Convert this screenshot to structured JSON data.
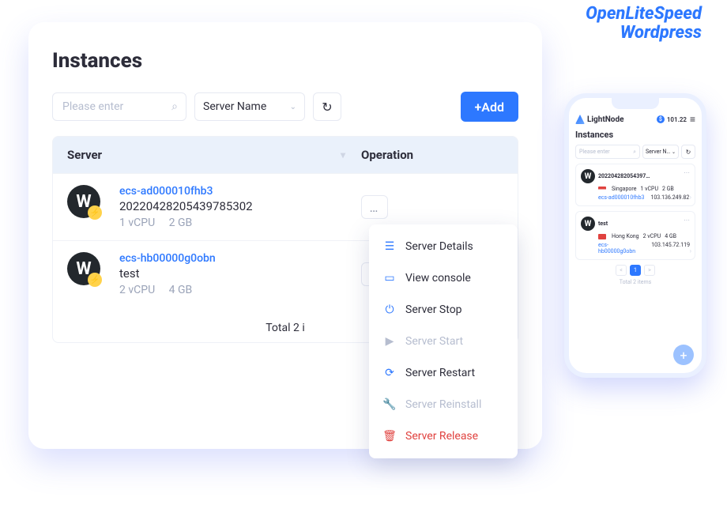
{
  "watermark": {
    "line1": "OpenLiteSpeed",
    "line2": "Wordpress"
  },
  "page": {
    "title": "Instances"
  },
  "toolbar": {
    "search_placeholder": "Please enter",
    "select_label": "Server Name",
    "add_label": "+Add"
  },
  "table": {
    "col_server": "Server",
    "col_operation": "Operation",
    "footer_total": "Total 2 i"
  },
  "rows": [
    {
      "link": "ecs-ad000010fhb3",
      "name": "20220428205439785302",
      "cpu": "1 vCPU",
      "mem": "2 GB"
    },
    {
      "link": "ecs-hb00000g0obn",
      "name": "test",
      "cpu": "2 vCPU",
      "mem": "4 GB"
    }
  ],
  "menu": {
    "details": "Server Details",
    "console": "View console",
    "stop": "Server Stop",
    "start": "Server Start",
    "restart": "Server Restart",
    "reinstall": "Server Reinstall",
    "release": "Server Release"
  },
  "phone": {
    "brand": "LightNode",
    "balance": "101.22",
    "title": "Instances",
    "search_placeholder": "Please enter",
    "select_label": "Server N…",
    "total": "Total 2 items",
    "cards": [
      {
        "name": "202204282054397…",
        "flag": "sg",
        "region": "Singapore",
        "cpu": "1 vCPU",
        "mem": "2 GB",
        "link": "ecs-ad000010fhb3",
        "ip": "103.136.249.82"
      },
      {
        "name": "test",
        "flag": "hk",
        "region": "Hong Kong",
        "cpu": "2 vCPU",
        "mem": "4 GB",
        "link": "ecs-hb00000g0obn",
        "ip": "103.145.72.119"
      }
    ],
    "page_prev": "<",
    "page_current": "1",
    "page_next": ">"
  }
}
